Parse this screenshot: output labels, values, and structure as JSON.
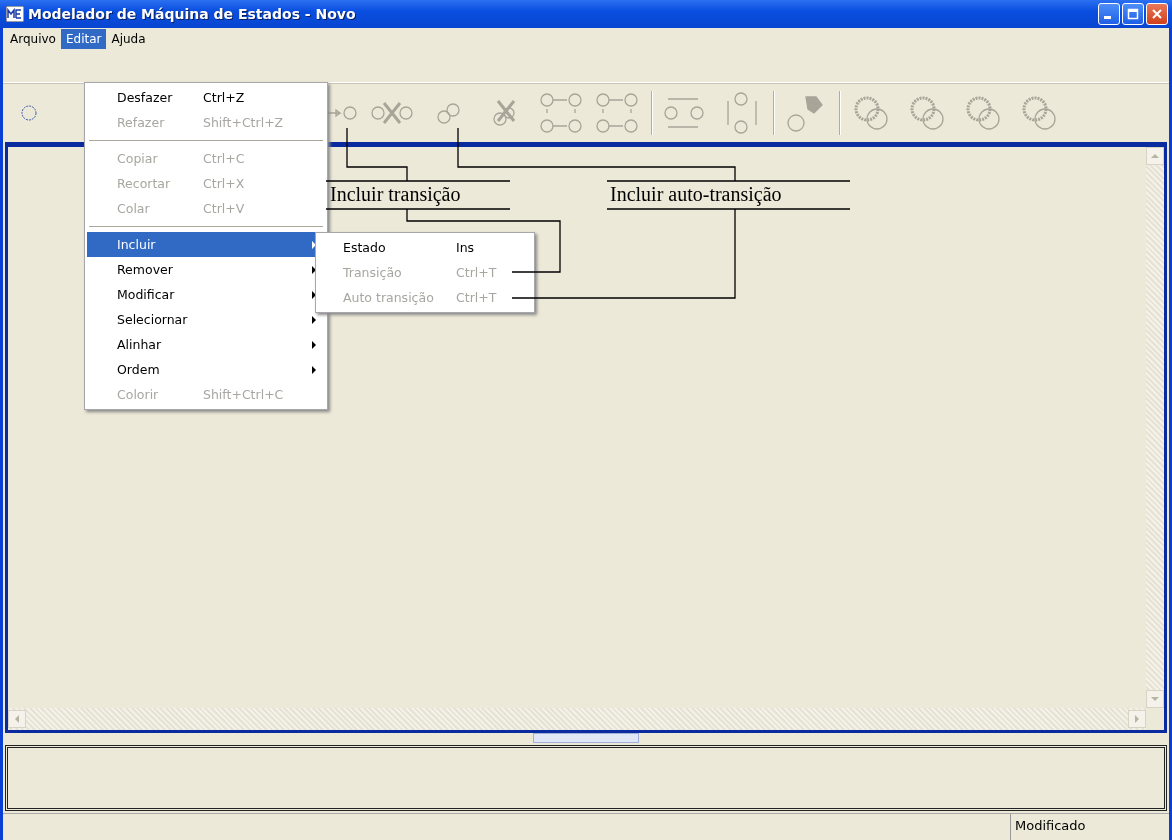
{
  "window": {
    "title": "Modelador de Máquina de Estados - Novo"
  },
  "menu_bar": [
    {
      "label": "Arquivo",
      "selected": false
    },
    {
      "label": "Editar",
      "selected": true
    },
    {
      "label": "Ajuda",
      "selected": false
    }
  ],
  "edit_menu": {
    "items": [
      {
        "kind": "item",
        "label": "Desfazer",
        "shortcut": "Ctrl+Z",
        "disabled": false,
        "submenu": false,
        "selected": false
      },
      {
        "kind": "item",
        "label": "Refazer",
        "shortcut": "Shift+Ctrl+Z",
        "disabled": true,
        "submenu": false,
        "selected": false
      },
      {
        "kind": "separator"
      },
      {
        "kind": "item",
        "label": "Copiar",
        "shortcut": "Ctrl+C",
        "disabled": true,
        "submenu": false,
        "selected": false
      },
      {
        "kind": "item",
        "label": "Recortar",
        "shortcut": "Ctrl+X",
        "disabled": true,
        "submenu": false,
        "selected": false
      },
      {
        "kind": "item",
        "label": "Colar",
        "shortcut": "Ctrl+V",
        "disabled": true,
        "submenu": false,
        "selected": false
      },
      {
        "kind": "separator"
      },
      {
        "kind": "item",
        "label": "Incluir",
        "disabled": false,
        "submenu": true,
        "selected": true
      },
      {
        "kind": "item",
        "label": "Remover",
        "disabled": false,
        "submenu": true,
        "selected": false
      },
      {
        "kind": "item",
        "label": "Modificar",
        "disabled": false,
        "submenu": true,
        "selected": false
      },
      {
        "kind": "item",
        "label": "Seleciornar",
        "disabled": false,
        "submenu": true,
        "selected": false
      },
      {
        "kind": "item",
        "label": "Alinhar",
        "disabled": false,
        "submenu": true,
        "selected": false
      },
      {
        "kind": "item",
        "label": "Ordem",
        "disabled": false,
        "submenu": true,
        "selected": false
      },
      {
        "kind": "item",
        "label": "Colorir",
        "shortcut": "Shift+Ctrl+C",
        "disabled": true,
        "submenu": false,
        "selected": false
      }
    ]
  },
  "include_submenu": {
    "items": [
      {
        "label": "Estado",
        "shortcut": "Ins",
        "disabled": false
      },
      {
        "label": "Transição",
        "shortcut": "Ctrl+T",
        "disabled": true
      },
      {
        "label": "Auto transição",
        "shortcut": "Ctrl+T",
        "disabled": true
      }
    ]
  },
  "annotations": [
    "Incluir transição",
    "Incluir auto-transição"
  ],
  "status_bar": {
    "text": "Modificado"
  }
}
